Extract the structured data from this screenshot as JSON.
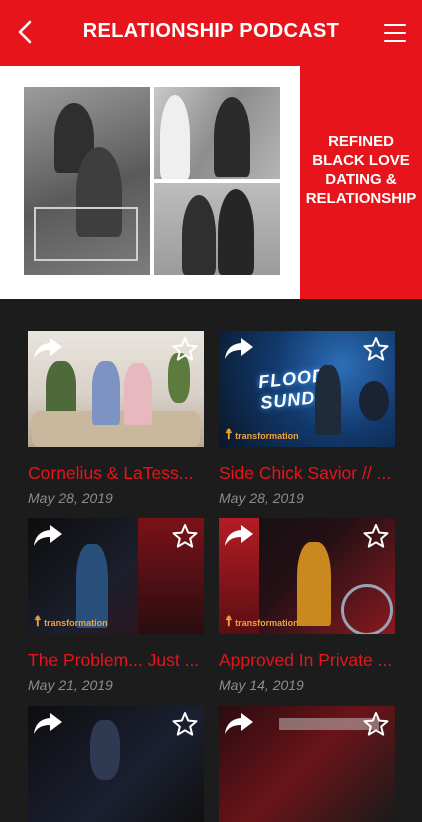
{
  "header": {
    "title": "RELATIONSHIP PODCAST"
  },
  "hero": {
    "text": "REFINED BLACK LOVE DATING & RELATIONSHIP",
    "lines": [
      "REFINED",
      "BLACK LOVE",
      "DATING &",
      "RELATIONSHIP"
    ]
  },
  "episodes": [
    {
      "title": "Cornelius & LaTess...",
      "date": "May 28, 2019",
      "thumb_style": "living-room"
    },
    {
      "title": "Side Chick Savior // ...",
      "date": "May 28, 2019",
      "thumb_style": "flood-sunday",
      "thumb_text": "FLOOD SUNDAY"
    },
    {
      "title": "The Problem... Just ...",
      "date": "May 21, 2019",
      "thumb_style": "stage-speaker"
    },
    {
      "title": "Approved In Private ...",
      "date": "May 14, 2019",
      "thumb_style": "stage-band"
    },
    {
      "title": "",
      "date": "",
      "thumb_style": "stage-dark"
    },
    {
      "title": "",
      "date": "",
      "thumb_style": "stage-marked"
    }
  ],
  "thumb_logo": "transformation",
  "icons": {
    "back": "chevron-left-icon",
    "menu": "hamburger-menu-icon",
    "share": "share-arrow-icon",
    "favorite": "star-outline-icon"
  },
  "colors": {
    "brand_red": "#e8141b",
    "background": "#1c1c1c",
    "date_gray": "#8c8c8c"
  }
}
